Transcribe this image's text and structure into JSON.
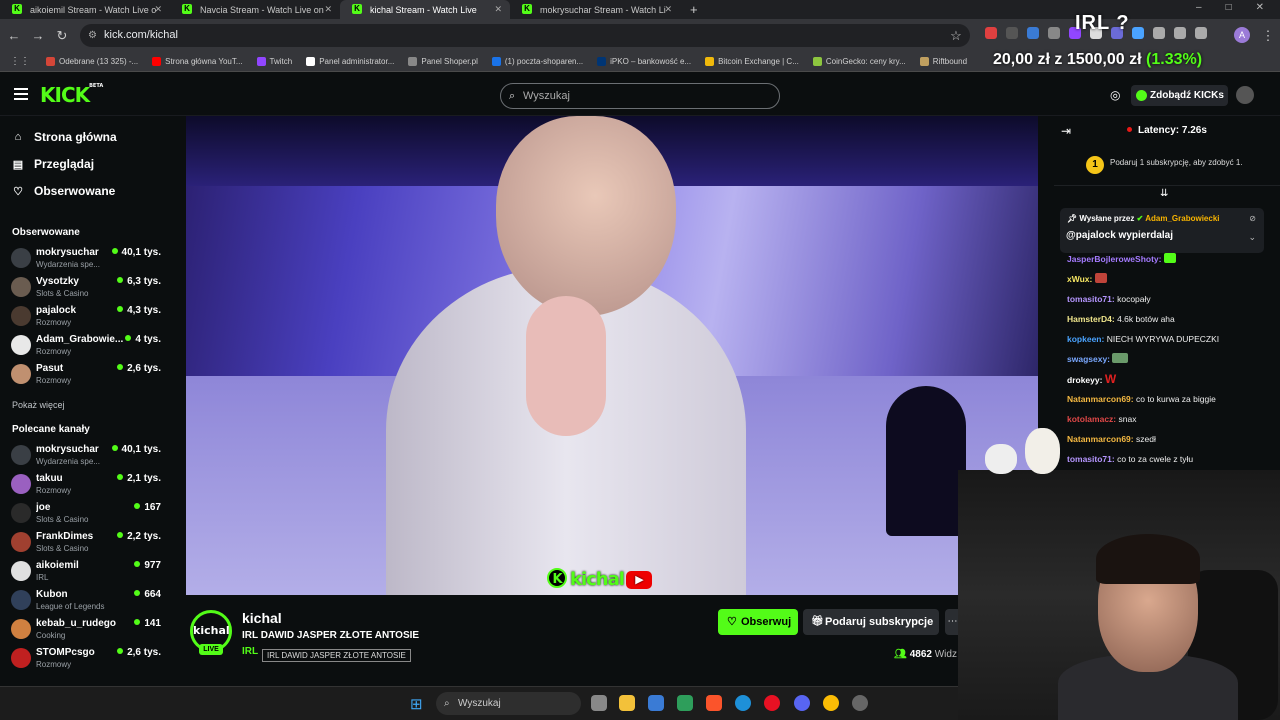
{
  "browser": {
    "tabs": [
      {
        "title": "aikoiemil Stream - Watch Live o"
      },
      {
        "title": "Navcia Stream - Watch Live on"
      },
      {
        "title": "kichal Stream - Watch Live"
      },
      {
        "title": "mokrysuchar Stream - Watch Li"
      }
    ],
    "url": "kick.com/kichal",
    "bookmarks": [
      {
        "label": "Odebrane (13 325) -...",
        "color": "#d44638"
      },
      {
        "label": "Strona główna YouT...",
        "color": "#ff0000"
      },
      {
        "label": "Twitch",
        "color": "#9146ff"
      },
      {
        "label": "Panel administrator...",
        "color": "#ffffff"
      },
      {
        "label": "Panel Shoper.pl",
        "color": "#888888"
      },
      {
        "label": "(1) poczta-shoparen...",
        "color": "#1a73e8"
      },
      {
        "label": "iPKO – bankowość e...",
        "color": "#003574"
      },
      {
        "label": "Bitcoin Exchange | C...",
        "color": "#f0b90b"
      },
      {
        "label": "CoinGecko: ceny kry...",
        "color": "#8dc63f"
      },
      {
        "label": "Riftbound",
        "color": "#c0a060"
      }
    ]
  },
  "overlay": {
    "irl_label": "IRL ?",
    "price_left": "20,00 zł",
    "price_main": "1500,00 zł",
    "price_pct": "(1.33%)"
  },
  "header": {
    "logo": "KICK",
    "logo_badge": "BETA",
    "search_placeholder": "Wyszukaj",
    "kicks_button": "Zdobądź KICKs"
  },
  "sidebar": {
    "nav": [
      {
        "label": "Strona główna",
        "icon": "home-icon"
      },
      {
        "label": "Przeglądaj",
        "icon": "browse-icon"
      },
      {
        "label": "Obserwowane",
        "icon": "heart-icon"
      }
    ],
    "followed_title": "Obserwowane",
    "followed": [
      {
        "name": "mokrysuchar",
        "category": "Wydarzenia spe...",
        "viewers": "40,1 tys.",
        "color": "#3a3f45"
      },
      {
        "name": "Vysotzky",
        "category": "Slots & Casino",
        "viewers": "6,3 tys.",
        "color": "#6a5c50"
      },
      {
        "name": "pajalock",
        "category": "Rozmowy",
        "viewers": "4,3 tys.",
        "color": "#4a3a30"
      },
      {
        "name": "Adam_Grabowie...",
        "category": "Rozmowy",
        "viewers": "4 tys.",
        "color": "#e8e8e8"
      },
      {
        "name": "Pasut",
        "category": "Rozmowy",
        "viewers": "2,6 tys.",
        "color": "#c09070"
      }
    ],
    "show_more": "Pokaż więcej",
    "recommended_title": "Polecane kanały",
    "recommended": [
      {
        "name": "mokrysuchar",
        "category": "Wydarzenia spe...",
        "viewers": "40,1 tys.",
        "color": "#3a3f45"
      },
      {
        "name": "takuu",
        "category": "Rozmowy",
        "viewers": "2,1 tys.",
        "color": "#9a60c0"
      },
      {
        "name": "joe",
        "category": "Slots & Casino",
        "viewers": "167",
        "color": "#2a2a2a"
      },
      {
        "name": "FrankDimes",
        "category": "Slots & Casino",
        "viewers": "2,2 tys.",
        "color": "#a04030"
      },
      {
        "name": "aikoiemil",
        "category": "IRL",
        "viewers": "977",
        "color": "#e0e0e0"
      },
      {
        "name": "Kubon",
        "category": "League of Legends",
        "viewers": "664",
        "color": "#30405a"
      },
      {
        "name": "kebab_u_rudego",
        "category": "Cooking",
        "viewers": "141",
        "color": "#d08040"
      },
      {
        "name": "STOMPcsgo",
        "category": "Rozmowy",
        "viewers": "2,6 tys.",
        "color": "#c02020"
      }
    ]
  },
  "stream": {
    "watermark": "kichal",
    "channel": "kichal",
    "avatar_text": "kichal",
    "live_badge": "LIVE",
    "title": "IRL DAWID JASPER ZŁOTE ANTOSIE",
    "category": "IRL",
    "tooltip": "IRL DAWID JASPER ZŁOTE ANTOSIE",
    "follow_label": "Obserwuj",
    "subscribe_label": "Podaruj subskrypcje",
    "viewers": "4862",
    "viewers_label": "Widz"
  },
  "chat": {
    "latency": "Latency: 7.26s",
    "sub_goal_number": "1",
    "sub_goal_text": "Podaruj 1 subskrypcję, aby zdobyć 1.",
    "pinned": {
      "sent_by": "Wysłane przez",
      "user": "Adam_Grabowiecki",
      "message": "@pajalock wypierdalaj"
    },
    "messages": [
      {
        "user": "JasperBojleroweShoty:",
        "text": "",
        "color": "#a57bff",
        "emote": "#53fc18"
      },
      {
        "user": "xWux:",
        "text": "",
        "color": "#f5e663",
        "emote": "#c0443a"
      },
      {
        "user": "tomasito71:",
        "text": "kocopały",
        "color": "#b596ff",
        "emote": ""
      },
      {
        "user": "HamsterD4:",
        "text": "4.6k botów aha",
        "color": "#f0e68c",
        "emote": ""
      },
      {
        "user": "kopkeen:",
        "text": "NIECH WYRYWA DUPECZKI",
        "color": "#4aa3ff",
        "emote": ""
      },
      {
        "user": "swagsexy:",
        "text": "",
        "color": "#7aa8ff",
        "emote": "#6a9a6a"
      },
      {
        "user": "drokeyy:",
        "text": "",
        "color": "#ffffff",
        "emote": "#e02020"
      },
      {
        "user": "Natanmarcon69:",
        "text": "co to kurwa za biggie",
        "color": "#f5b942",
        "emote": ""
      },
      {
        "user": "kotolamacz:",
        "text": "snax",
        "color": "#e04848",
        "emote": ""
      },
      {
        "user": "Natanmarcon69:",
        "text": "szedł",
        "color": "#f5b942",
        "emote": ""
      },
      {
        "user": "tomasito71:",
        "text": "co to za cwele z tyłu",
        "color": "#b596ff",
        "emote": ""
      }
    ]
  },
  "taskbar": {
    "search": "Wyszukaj"
  },
  "colors": {
    "accent": "#53fc18",
    "background": "#0b0e0f"
  }
}
